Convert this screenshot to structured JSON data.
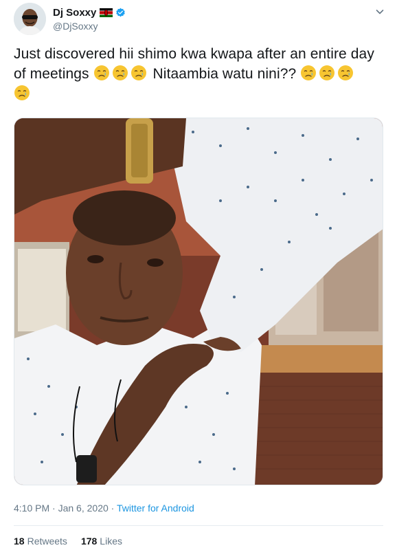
{
  "user": {
    "display_name": "Dj Soxxy",
    "handle": "@DjSoxxy",
    "flag_icon": "kenya-flag-icon",
    "verified_icon": "verified-badge-icon"
  },
  "tweet": {
    "text_line1": "Just discovered hii shimo kwa kwapa after an entire day",
    "text_line2_prefix": "of meetings",
    "text_line2_suffix": "Nitaambia watu nini??",
    "emoji": "crying-face-icon"
  },
  "meta": {
    "time": "4:10 PM",
    "separator": "·",
    "date": "Jan 6, 2020",
    "via": "Twitter for Android"
  },
  "stats": {
    "retweets_count": "18",
    "retweets_label": "Retweets",
    "likes_count": "178",
    "likes_label": "Likes"
  },
  "colors": {
    "accent": "#1b95e0",
    "muted": "#657786",
    "text": "#14171a"
  }
}
